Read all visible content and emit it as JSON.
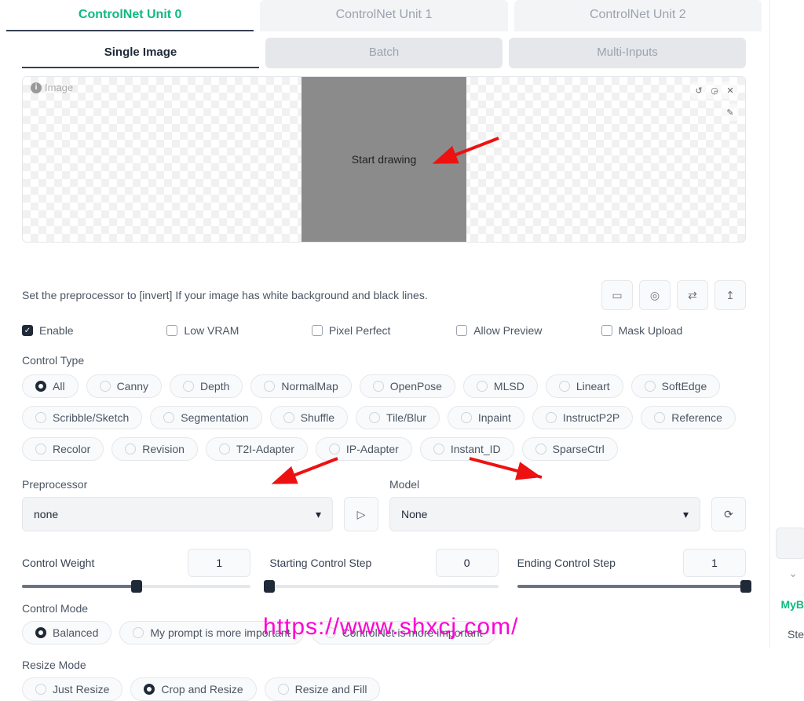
{
  "main_tabs": [
    "ControlNet Unit 0",
    "ControlNet Unit 1",
    "ControlNet Unit 2"
  ],
  "sub_tabs": [
    "Single Image",
    "Batch",
    "Multi-Inputs"
  ],
  "image_area": {
    "corner_label": "Image",
    "center_text": "Start drawing"
  },
  "hint": "Set the preprocessor to [invert] If your image has white background and black lines.",
  "checks": {
    "enable": "Enable",
    "lowvram": "Low VRAM",
    "pixel": "Pixel Perfect",
    "preview": "Allow Preview",
    "mask": "Mask Upload"
  },
  "control_type_label": "Control Type",
  "control_types": [
    "All",
    "Canny",
    "Depth",
    "NormalMap",
    "OpenPose",
    "MLSD",
    "Lineart",
    "SoftEdge",
    "Scribble/Sketch",
    "Segmentation",
    "Shuffle",
    "Tile/Blur",
    "Inpaint",
    "InstructP2P",
    "Reference",
    "Recolor",
    "Revision",
    "T2I-Adapter",
    "IP-Adapter",
    "Instant_ID",
    "SparseCtrl"
  ],
  "preprocessor": {
    "label": "Preprocessor",
    "value": "none"
  },
  "model": {
    "label": "Model",
    "value": "None"
  },
  "sliders": {
    "weight": {
      "label": "Control Weight",
      "value": "1",
      "percent": 50
    },
    "start": {
      "label": "Starting Control Step",
      "value": "0",
      "percent": 0
    },
    "end": {
      "label": "Ending Control Step",
      "value": "1",
      "percent": 100
    }
  },
  "control_mode": {
    "label": "Control Mode",
    "options": [
      "Balanced",
      "My prompt is more important",
      "ControlNet is more important"
    ]
  },
  "resize_mode": {
    "label": "Resize Mode",
    "options": [
      "Just Resize",
      "Crop and Resize",
      "Resize and Fill"
    ]
  },
  "watermark": "https://www.shxcj.com/",
  "right": {
    "txt1": "MyB",
    "txt2": "Ste"
  }
}
